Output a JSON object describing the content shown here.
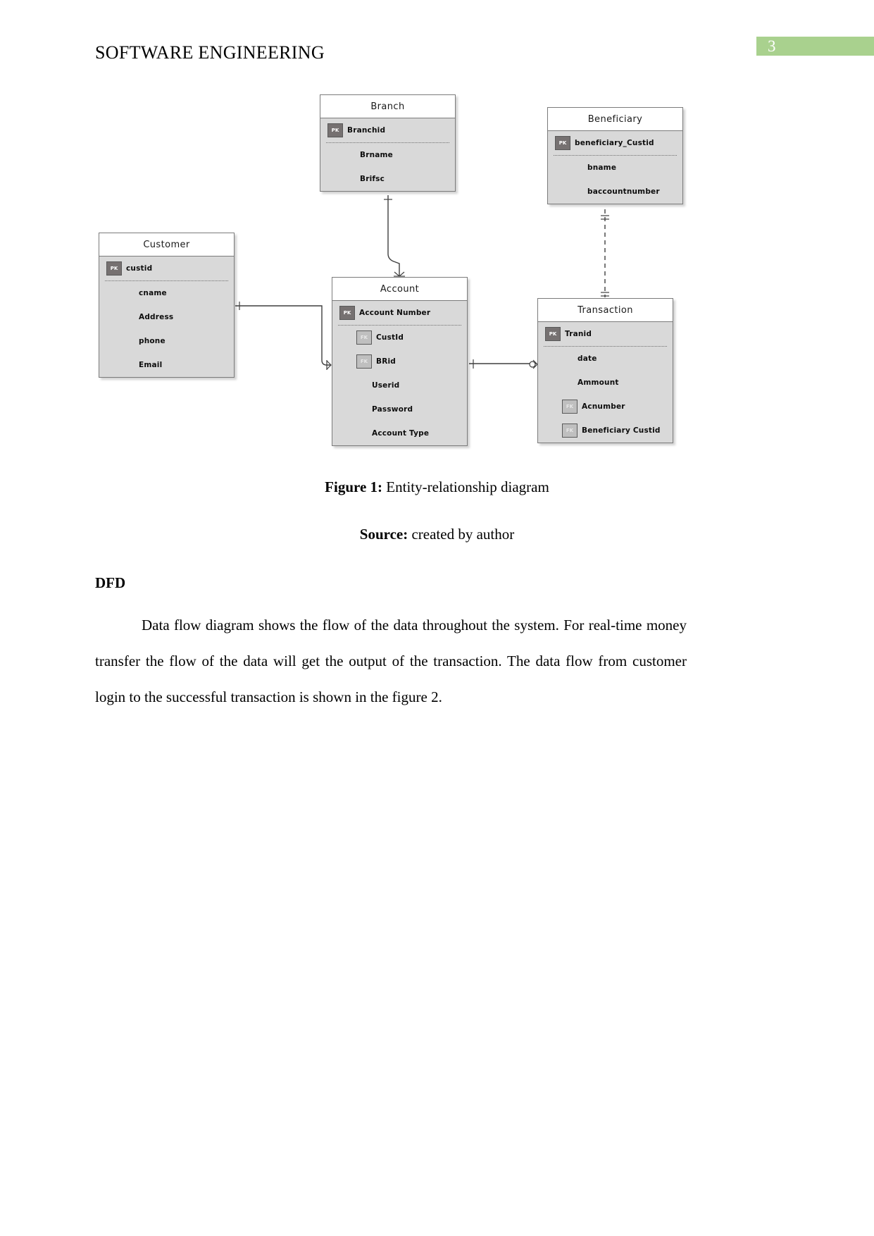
{
  "header": {
    "title": "SOFTWARE ENGINEERING",
    "page_number": "3",
    "page_number_bg": "#a9d18e"
  },
  "figure": {
    "caption_label": "Figure 1:",
    "caption_text": " Entity-relationship diagram",
    "source_label": "Source:",
    "source_text": " created by author"
  },
  "section": {
    "heading": "DFD",
    "paragraph": "Data flow diagram shows the flow of the data throughout the system. For real-time money transfer the flow of the data will get the output of the transaction. The data flow from customer login to the successful transaction is shown in the figure 2."
  },
  "chart_data": {
    "type": "diagram",
    "diagram_kind": "entity-relationship",
    "title": "Entity-relationship diagram",
    "entities": [
      {
        "id": "branch",
        "name": "Branch",
        "attributes": [
          {
            "name": "Branchid",
            "key": "PK"
          },
          {
            "name": "Brname",
            "key": ""
          },
          {
            "name": "Brifsc",
            "key": ""
          }
        ]
      },
      {
        "id": "beneficiary",
        "name": "Beneficiary",
        "attributes": [
          {
            "name": "beneficiary_Custid",
            "key": "PK"
          },
          {
            "name": "bname",
            "key": ""
          },
          {
            "name": "baccountnumber",
            "key": ""
          }
        ]
      },
      {
        "id": "customer",
        "name": "Customer",
        "attributes": [
          {
            "name": "custid",
            "key": "PK"
          },
          {
            "name": "cname",
            "key": ""
          },
          {
            "name": "Address",
            "key": ""
          },
          {
            "name": "phone",
            "key": ""
          },
          {
            "name": "Email",
            "key": ""
          }
        ]
      },
      {
        "id": "account",
        "name": "Account",
        "attributes": [
          {
            "name": "Account Number",
            "key": "PK"
          },
          {
            "name": "CustId",
            "key": "FK"
          },
          {
            "name": "BRid",
            "key": "FK"
          },
          {
            "name": "Userid",
            "key": ""
          },
          {
            "name": "Password",
            "key": ""
          },
          {
            "name": "Account Type",
            "key": ""
          }
        ]
      },
      {
        "id": "transaction",
        "name": "Transaction",
        "attributes": [
          {
            "name": "Tranid",
            "key": "PK"
          },
          {
            "name": "date",
            "key": ""
          },
          {
            "name": "Ammount",
            "key": ""
          },
          {
            "name": "Acnumber",
            "key": "FK"
          },
          {
            "name": "Beneficiary Custid",
            "key": "FK"
          }
        ]
      }
    ],
    "relationships": [
      {
        "from": "branch",
        "to": "account",
        "style": "solid"
      },
      {
        "from": "customer",
        "to": "account",
        "style": "solid"
      },
      {
        "from": "account",
        "to": "transaction",
        "style": "solid"
      },
      {
        "from": "beneficiary",
        "to": "transaction",
        "style": "dashed"
      }
    ],
    "colors": {
      "entity_body": "#d9d9d9",
      "entity_header": "#ffffff",
      "entity_border": "#7b7b7b",
      "pk_badge": "#767171",
      "fk_badge": "#bfbfbf"
    }
  }
}
